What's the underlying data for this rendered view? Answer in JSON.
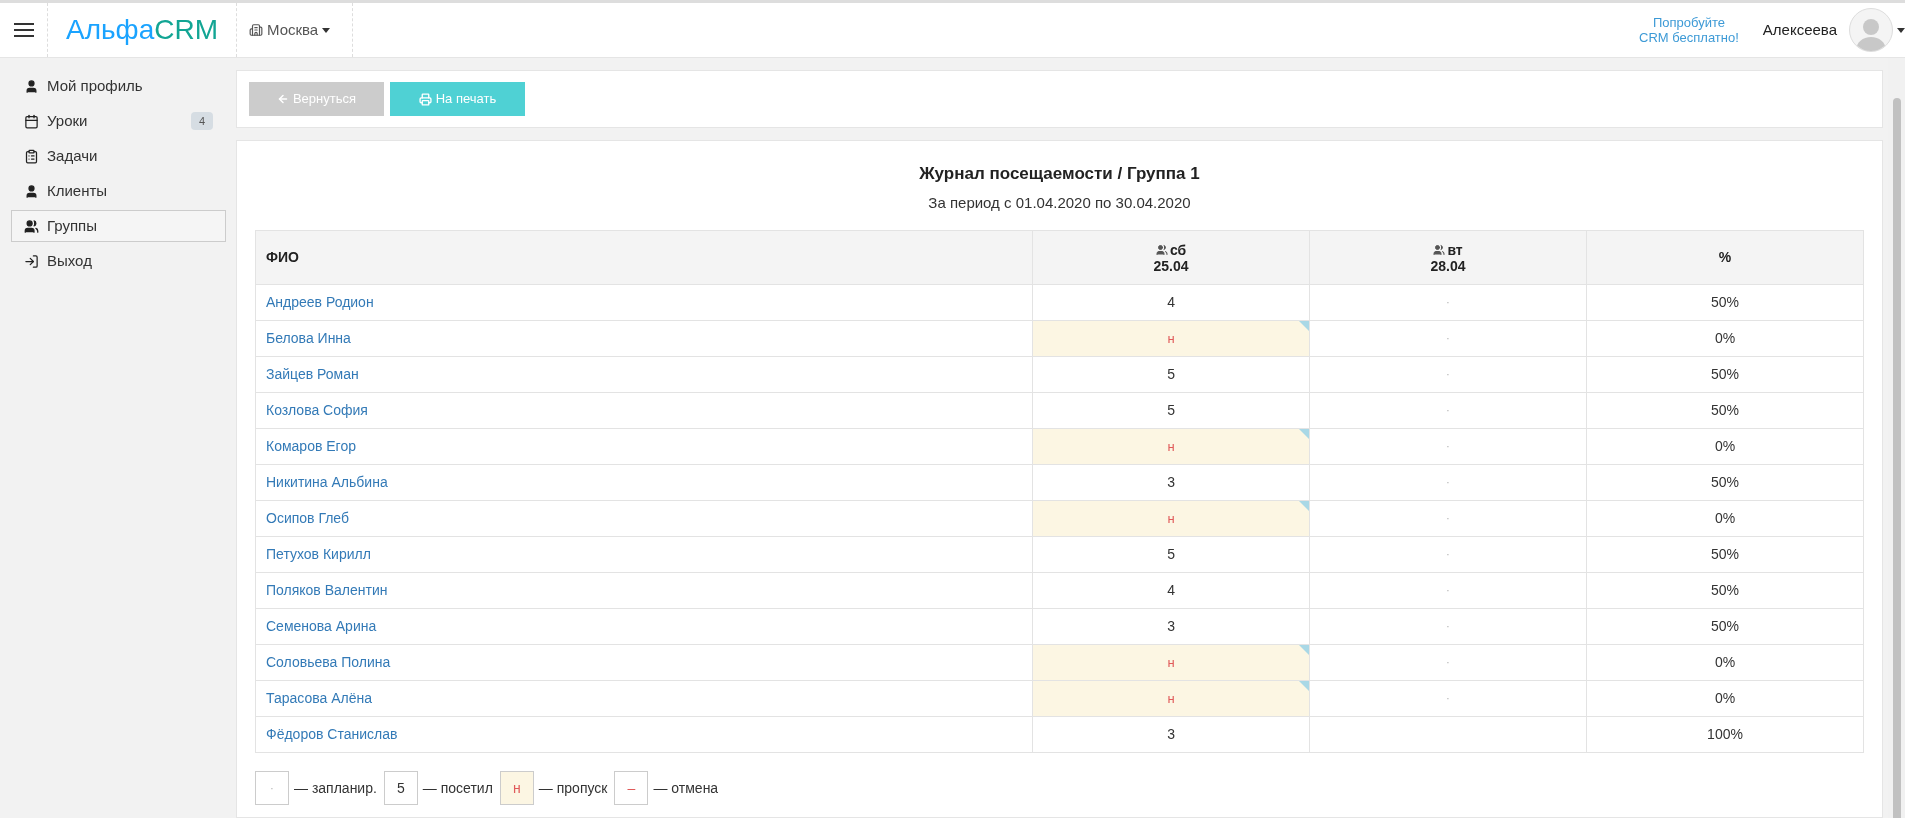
{
  "header": {
    "logo": {
      "part1": "Альфа",
      "part2": "CRM"
    },
    "branch": "Москва",
    "promo": [
      "Попробуйте",
      "CRM бесплатно!"
    ],
    "user": "Алексеева"
  },
  "sidebar": {
    "items": [
      {
        "label": "Мой профиль",
        "selected": false
      },
      {
        "label": "Уроки",
        "selected": false,
        "badge": "4"
      },
      {
        "label": "Задачи",
        "selected": false
      },
      {
        "label": "Клиенты",
        "selected": false
      },
      {
        "label": "Группы",
        "selected": true
      },
      {
        "label": "Выход",
        "selected": false
      }
    ]
  },
  "toolbar": {
    "buttons": [
      {
        "label": "Вернуться",
        "kind": "back"
      },
      {
        "label": "На печать",
        "kind": "print"
      }
    ]
  },
  "journal": {
    "title": "Журнал посещаемости / Группа 1",
    "period": "За период с 01.04.2020 по 30.04.2020",
    "columns": [
      {
        "kind": "name",
        "label": "ФИО"
      },
      {
        "kind": "lesson",
        "day": "сб",
        "date": "25.04"
      },
      {
        "kind": "lesson",
        "day": "вт",
        "date": "28.04"
      },
      {
        "kind": "percent",
        "label": "%"
      }
    ],
    "rows": [
      {
        "cells": [
          {
            "kind": "name",
            "text": "Андреев Родион"
          },
          {
            "kind": "grade",
            "text": "4"
          },
          {
            "kind": "planned",
            "text": "·"
          },
          {
            "kind": "percent",
            "text": "50%"
          }
        ]
      },
      {
        "cells": [
          {
            "kind": "name",
            "text": "Белова Инна"
          },
          {
            "kind": "absent",
            "text": "н",
            "comment": true
          },
          {
            "kind": "planned",
            "text": "·"
          },
          {
            "kind": "percent",
            "text": "0%"
          }
        ]
      },
      {
        "cells": [
          {
            "kind": "name",
            "text": "Зайцев Роман"
          },
          {
            "kind": "grade",
            "text": "5"
          },
          {
            "kind": "planned",
            "text": "·"
          },
          {
            "kind": "percent",
            "text": "50%"
          }
        ]
      },
      {
        "cells": [
          {
            "kind": "name",
            "text": "Козлова София"
          },
          {
            "kind": "grade",
            "text": "5"
          },
          {
            "kind": "planned",
            "text": "·"
          },
          {
            "kind": "percent",
            "text": "50%"
          }
        ]
      },
      {
        "cells": [
          {
            "kind": "name",
            "text": "Комаров Егор"
          },
          {
            "kind": "absent",
            "text": "н",
            "comment": true
          },
          {
            "kind": "planned",
            "text": "·"
          },
          {
            "kind": "percent",
            "text": "0%"
          }
        ]
      },
      {
        "cells": [
          {
            "kind": "name",
            "text": "Никитина Альбина"
          },
          {
            "kind": "grade",
            "text": "3"
          },
          {
            "kind": "planned",
            "text": "·"
          },
          {
            "kind": "percent",
            "text": "50%"
          }
        ]
      },
      {
        "cells": [
          {
            "kind": "name",
            "text": "Осипов Глеб"
          },
          {
            "kind": "absent",
            "text": "н",
            "comment": true
          },
          {
            "kind": "planned",
            "text": "·"
          },
          {
            "kind": "percent",
            "text": "0%"
          }
        ]
      },
      {
        "cells": [
          {
            "kind": "name",
            "text": "Петухов Кирилл"
          },
          {
            "kind": "grade",
            "text": "5"
          },
          {
            "kind": "planned",
            "text": "·"
          },
          {
            "kind": "percent",
            "text": "50%"
          }
        ]
      },
      {
        "cells": [
          {
            "kind": "name",
            "text": "Поляков Валентин"
          },
          {
            "kind": "grade",
            "text": "4"
          },
          {
            "kind": "planned",
            "text": "·"
          },
          {
            "kind": "percent",
            "text": "50%"
          }
        ]
      },
      {
        "cells": [
          {
            "kind": "name",
            "text": "Семенова Арина"
          },
          {
            "kind": "grade",
            "text": "3"
          },
          {
            "kind": "planned",
            "text": "·"
          },
          {
            "kind": "percent",
            "text": "50%"
          }
        ]
      },
      {
        "cells": [
          {
            "kind": "name",
            "text": "Соловьева Полина"
          },
          {
            "kind": "absent",
            "text": "н",
            "comment": true
          },
          {
            "kind": "planned",
            "text": "·"
          },
          {
            "kind": "percent",
            "text": "0%"
          }
        ]
      },
      {
        "cells": [
          {
            "kind": "name",
            "text": "Тарасова Алёна"
          },
          {
            "kind": "absent",
            "text": "н",
            "comment": true
          },
          {
            "kind": "planned",
            "text": "·"
          },
          {
            "kind": "percent",
            "text": "0%"
          }
        ]
      },
      {
        "cells": [
          {
            "kind": "name",
            "text": "Фёдоров Станислав"
          },
          {
            "kind": "grade",
            "text": "3"
          },
          {
            "kind": "empty"
          },
          {
            "kind": "percent",
            "text": "100%"
          }
        ]
      }
    ],
    "legend": [
      {
        "kind": "planned",
        "mark": "·",
        "label": "— запланир."
      },
      {
        "kind": "grade",
        "mark": "5",
        "label": "— посетил"
      },
      {
        "kind": "absent",
        "mark": "н",
        "label": "— пропуск"
      },
      {
        "kind": "cancelled",
        "mark": "–",
        "label": "— отмена"
      }
    ]
  }
}
